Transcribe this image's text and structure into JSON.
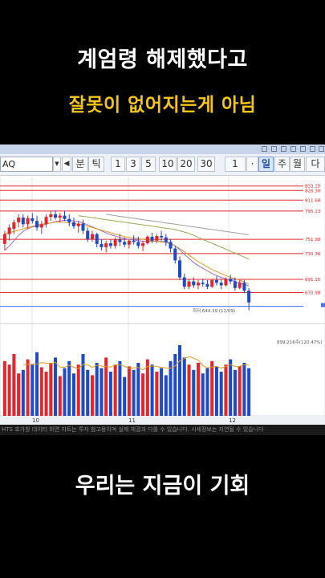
{
  "headline": {
    "line1": "계엄령 해제했다고",
    "line2": "잘못이 없어지는게 아님"
  },
  "caption": "우리는 지금이 기회",
  "toolbar": {
    "symbol": "AQ",
    "buttons": [
      "분",
      "틱",
      "1",
      "3",
      "5",
      "10",
      "20",
      "30",
      "1",
      "·",
      "일",
      "주",
      "월",
      "다"
    ],
    "active": "일"
  },
  "colors": {
    "up": "#e3262c",
    "down": "#1f49c7",
    "ma_orange": "#e59a1e",
    "ma_green": "#9aaa52",
    "ma_purple": "#9c6fc0",
    "ma_gray": "#a0a0a0",
    "level_line": "#e22a2a",
    "blue_line": "#4a6ff0",
    "headline_yellow": "#f5c518"
  },
  "status_text": "HTS 호가창 데이터 화면 차트는 투자 참고용이며 실제 체결과 다를 수 있습니다. 시세정보는 지연될 수 있습니다",
  "chart_data": {
    "type": "candlestick",
    "price_axis_labels": [
      "833.15",
      "826.30",
      "811.68",
      "795.13",
      "751.98",
      "730.36",
      "691.15",
      "670.98"
    ],
    "level_lines": [
      833.15,
      826.3,
      811.68,
      795.13,
      751.98,
      730.36,
      691.15,
      670.98
    ],
    "low_annotation": "최저 644.39 (12/09)",
    "volume_annotation": "899,216주(120.47%)",
    "x_tick_labels": [
      "10",
      "11",
      "12"
    ],
    "ylim": [
      630,
      845
    ],
    "candles": [
      [
        745,
        765,
        735,
        760
      ],
      [
        760,
        775,
        750,
        770
      ],
      [
        768,
        782,
        760,
        778
      ],
      [
        778,
        790,
        770,
        785
      ],
      [
        785,
        790,
        770,
        775
      ],
      [
        775,
        788,
        768,
        784
      ],
      [
        784,
        792,
        776,
        780
      ],
      [
        780,
        788,
        765,
        770
      ],
      [
        770,
        780,
        760,
        775
      ],
      [
        775,
        790,
        770,
        786
      ],
      [
        786,
        795,
        780,
        790
      ],
      [
        790,
        796,
        782,
        785
      ],
      [
        785,
        792,
        778,
        788
      ],
      [
        788,
        795,
        780,
        783
      ],
      [
        783,
        790,
        772,
        778
      ],
      [
        778,
        785,
        768,
        772
      ],
      [
        772,
        780,
        762,
        776
      ],
      [
        776,
        782,
        760,
        765
      ],
      [
        765,
        770,
        748,
        752
      ],
      [
        752,
        765,
        748,
        760
      ],
      [
        760,
        762,
        740,
        745
      ],
      [
        745,
        752,
        735,
        740
      ],
      [
        740,
        750,
        732,
        746
      ],
      [
        746,
        752,
        738,
        742
      ],
      [
        742,
        755,
        738,
        752
      ],
      [
        752,
        760,
        742,
        748
      ],
      [
        748,
        755,
        740,
        744
      ],
      [
        744,
        752,
        738,
        750
      ],
      [
        750,
        758,
        744,
        748
      ],
      [
        748,
        756,
        738,
        742
      ],
      [
        742,
        750,
        734,
        746
      ],
      [
        746,
        758,
        744,
        756
      ],
      [
        756,
        762,
        746,
        750
      ],
      [
        750,
        760,
        746,
        757
      ],
      [
        757,
        765,
        750,
        755
      ],
      [
        755,
        760,
        742,
        748
      ],
      [
        748,
        752,
        732,
        738
      ],
      [
        738,
        742,
        715,
        720
      ],
      [
        720,
        726,
        690,
        694
      ],
      [
        694,
        700,
        676,
        680
      ],
      [
        680,
        692,
        676,
        688
      ],
      [
        688,
        694,
        678,
        682
      ],
      [
        682,
        690,
        676,
        686
      ],
      [
        686,
        692,
        680,
        684
      ],
      [
        684,
        690,
        676,
        680
      ],
      [
        680,
        692,
        678,
        690
      ],
      [
        690,
        696,
        682,
        686
      ],
      [
        686,
        692,
        676,
        682
      ],
      [
        682,
        694,
        680,
        692
      ],
      [
        692,
        698,
        684,
        688
      ],
      [
        688,
        694,
        674,
        678
      ],
      [
        678,
        690,
        676,
        686
      ],
      [
        686,
        690,
        670,
        674
      ],
      [
        674,
        678,
        644,
        656
      ]
    ],
    "volumes": [
      62,
      58,
      70,
      48,
      52,
      64,
      58,
      72,
      55,
      50,
      60,
      66,
      45,
      54,
      62,
      48,
      58,
      70,
      52,
      46,
      60,
      54,
      66,
      50,
      58,
      62,
      44,
      56,
      52,
      60,
      48,
      64,
      58,
      50,
      54,
      46,
      62,
      70,
      80,
      66,
      58,
      52,
      60,
      48,
      54,
      62,
      56,
      50,
      58,
      64,
      52,
      56,
      60,
      54
    ],
    "moving_averages": [
      {
        "values": [
          735,
          742,
          750,
          758,
          764,
          768,
          771,
          772,
          773,
          775,
          777,
          779,
          780,
          781,
          781,
          780,
          779,
          777,
          774,
          771,
          768,
          765,
          762,
          759,
          757,
          755,
          753,
          752,
          751,
          750,
          749,
          749,
          749,
          749,
          749,
          748,
          746,
          742,
          736,
          729,
          723,
          717,
          712,
          708,
          704,
          700,
          697,
          694,
          692,
          690,
          688,
          686,
          684,
          681
        ]
      },
      {
        "values": [
          760,
          762,
          764,
          766,
          768,
          770,
          772,
          774,
          775,
          776,
          777,
          778,
          778,
          778,
          777,
          776,
          775,
          774,
          772,
          770,
          768,
          766,
          764,
          762,
          760,
          758,
          756,
          755,
          754,
          753,
          752,
          751,
          750,
          749,
          748,
          747,
          745,
          742,
          738,
          733,
          728,
          723,
          718,
          714,
          710,
          706,
          703,
          700,
          697,
          694,
          692,
          690,
          687,
          684
        ]
      },
      {
        "values": [
          null,
          null,
          null,
          null,
          null,
          null,
          null,
          null,
          null,
          null,
          null,
          null,
          null,
          null,
          null,
          null,
          788,
          787,
          786,
          785,
          784,
          783,
          782,
          781,
          780,
          779,
          778,
          777,
          776,
          775,
          774,
          773,
          772,
          771,
          770,
          769,
          768,
          767,
          765,
          763,
          761,
          758,
          755,
          752,
          749,
          746,
          743,
          740,
          737,
          734,
          731,
          728,
          725,
          722
        ]
      },
      {
        "values": [
          null,
          null,
          null,
          null,
          null,
          null,
          null,
          null,
          null,
          null,
          null,
          null,
          null,
          null,
          null,
          null,
          null,
          null,
          null,
          null,
          null,
          null,
          790,
          789,
          788,
          787,
          786,
          785,
          784,
          783,
          782,
          781,
          780,
          779,
          778,
          777,
          776,
          775,
          774,
          773,
          772,
          771,
          770,
          769,
          768,
          767,
          766,
          765,
          764,
          763,
          762,
          761,
          760,
          759
        ]
      }
    ]
  }
}
